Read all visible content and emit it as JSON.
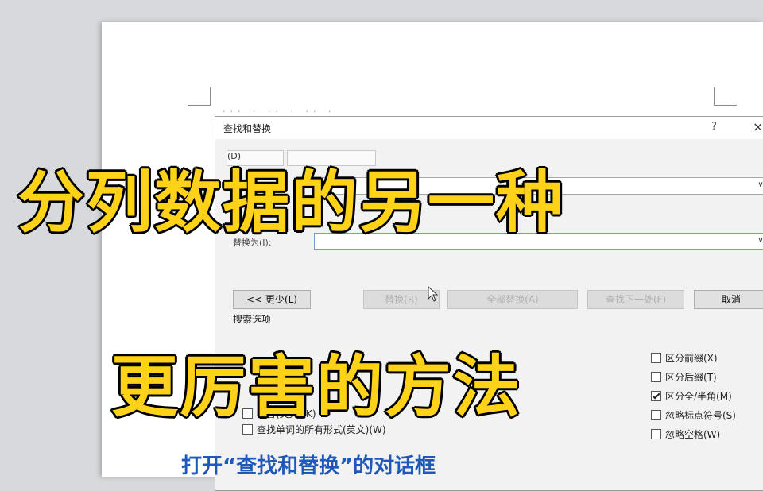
{
  "dialog": {
    "title": "查找和替换",
    "help": "?",
    "close": "×",
    "tabs": [
      "(D)",
      ""
    ],
    "replace_label": "替换为(I):",
    "dropdown_arrow": "∨",
    "buttons": {
      "less": "<< 更少(L)",
      "replace": "替换(R)",
      "replace_all": "全部替换(A)",
      "find_next": "查找下一处(F)",
      "cancel": "取消"
    },
    "search_options_label": "搜索选项",
    "left_options": [
      {
        "label": "同音(英文)(K)",
        "checked": false
      },
      {
        "label": "查找单词的所有形式(英文)(W)",
        "checked": false
      }
    ],
    "right_options": [
      {
        "label": "区分前缀(X)",
        "checked": false
      },
      {
        "label": "区分后缀(T)",
        "checked": false
      },
      {
        "label": "区分全/半角(M)",
        "checked": true
      },
      {
        "label": "忽略标点符号(S)",
        "checked": false
      },
      {
        "label": "忽略空格(W)",
        "checked": false
      }
    ]
  },
  "document": {
    "faded_line": "···  ·  ··  ·  ··  ·"
  },
  "overlay": {
    "headline_1": "分列数据的另一种",
    "headline_2": "更厉害的方法",
    "caption": "打开“查找和替换”的对话框",
    "headline_color": "#ffd21a",
    "caption_color": "#1e58b8"
  }
}
